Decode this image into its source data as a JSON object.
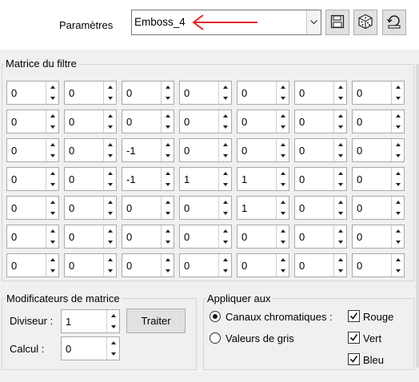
{
  "header": {
    "params_label": "Paramètres",
    "preset_value": "Emboss_4",
    "buttons": [
      "save-icon",
      "dice-icon",
      "reset-icon"
    ]
  },
  "matrix": {
    "title": "Matrice du filtre",
    "rows": [
      [
        "0",
        "0",
        "0",
        "0",
        "0",
        "0",
        "0"
      ],
      [
        "0",
        "0",
        "0",
        "0",
        "0",
        "0",
        "0"
      ],
      [
        "0",
        "0",
        "-1",
        "0",
        "0",
        "0",
        "0"
      ],
      [
        "0",
        "0",
        "-1",
        "1",
        "1",
        "0",
        "0"
      ],
      [
        "0",
        "0",
        "0",
        "0",
        "1",
        "0",
        "0"
      ],
      [
        "0",
        "0",
        "0",
        "0",
        "0",
        "0",
        "0"
      ],
      [
        "0",
        "0",
        "0",
        "0",
        "0",
        "0",
        "0"
      ]
    ]
  },
  "modifiers": {
    "title": "Modificateurs de matrice",
    "divisor_label": "Diviseur :",
    "divisor_value": "1",
    "calc_label": "Calcul :",
    "calc_value": "0",
    "apply_button": "Traiter"
  },
  "apply": {
    "title": "Appliquer aux",
    "option_color": "Canaux chromatiques :",
    "option_gray": "Valeurs de gris",
    "selected": "color",
    "channels": [
      {
        "label": "Rouge",
        "checked": true
      },
      {
        "label": "Vert",
        "checked": true
      },
      {
        "label": "Bleu",
        "checked": true
      }
    ]
  },
  "colors": {
    "annotation_arrow": "#e8242a"
  }
}
